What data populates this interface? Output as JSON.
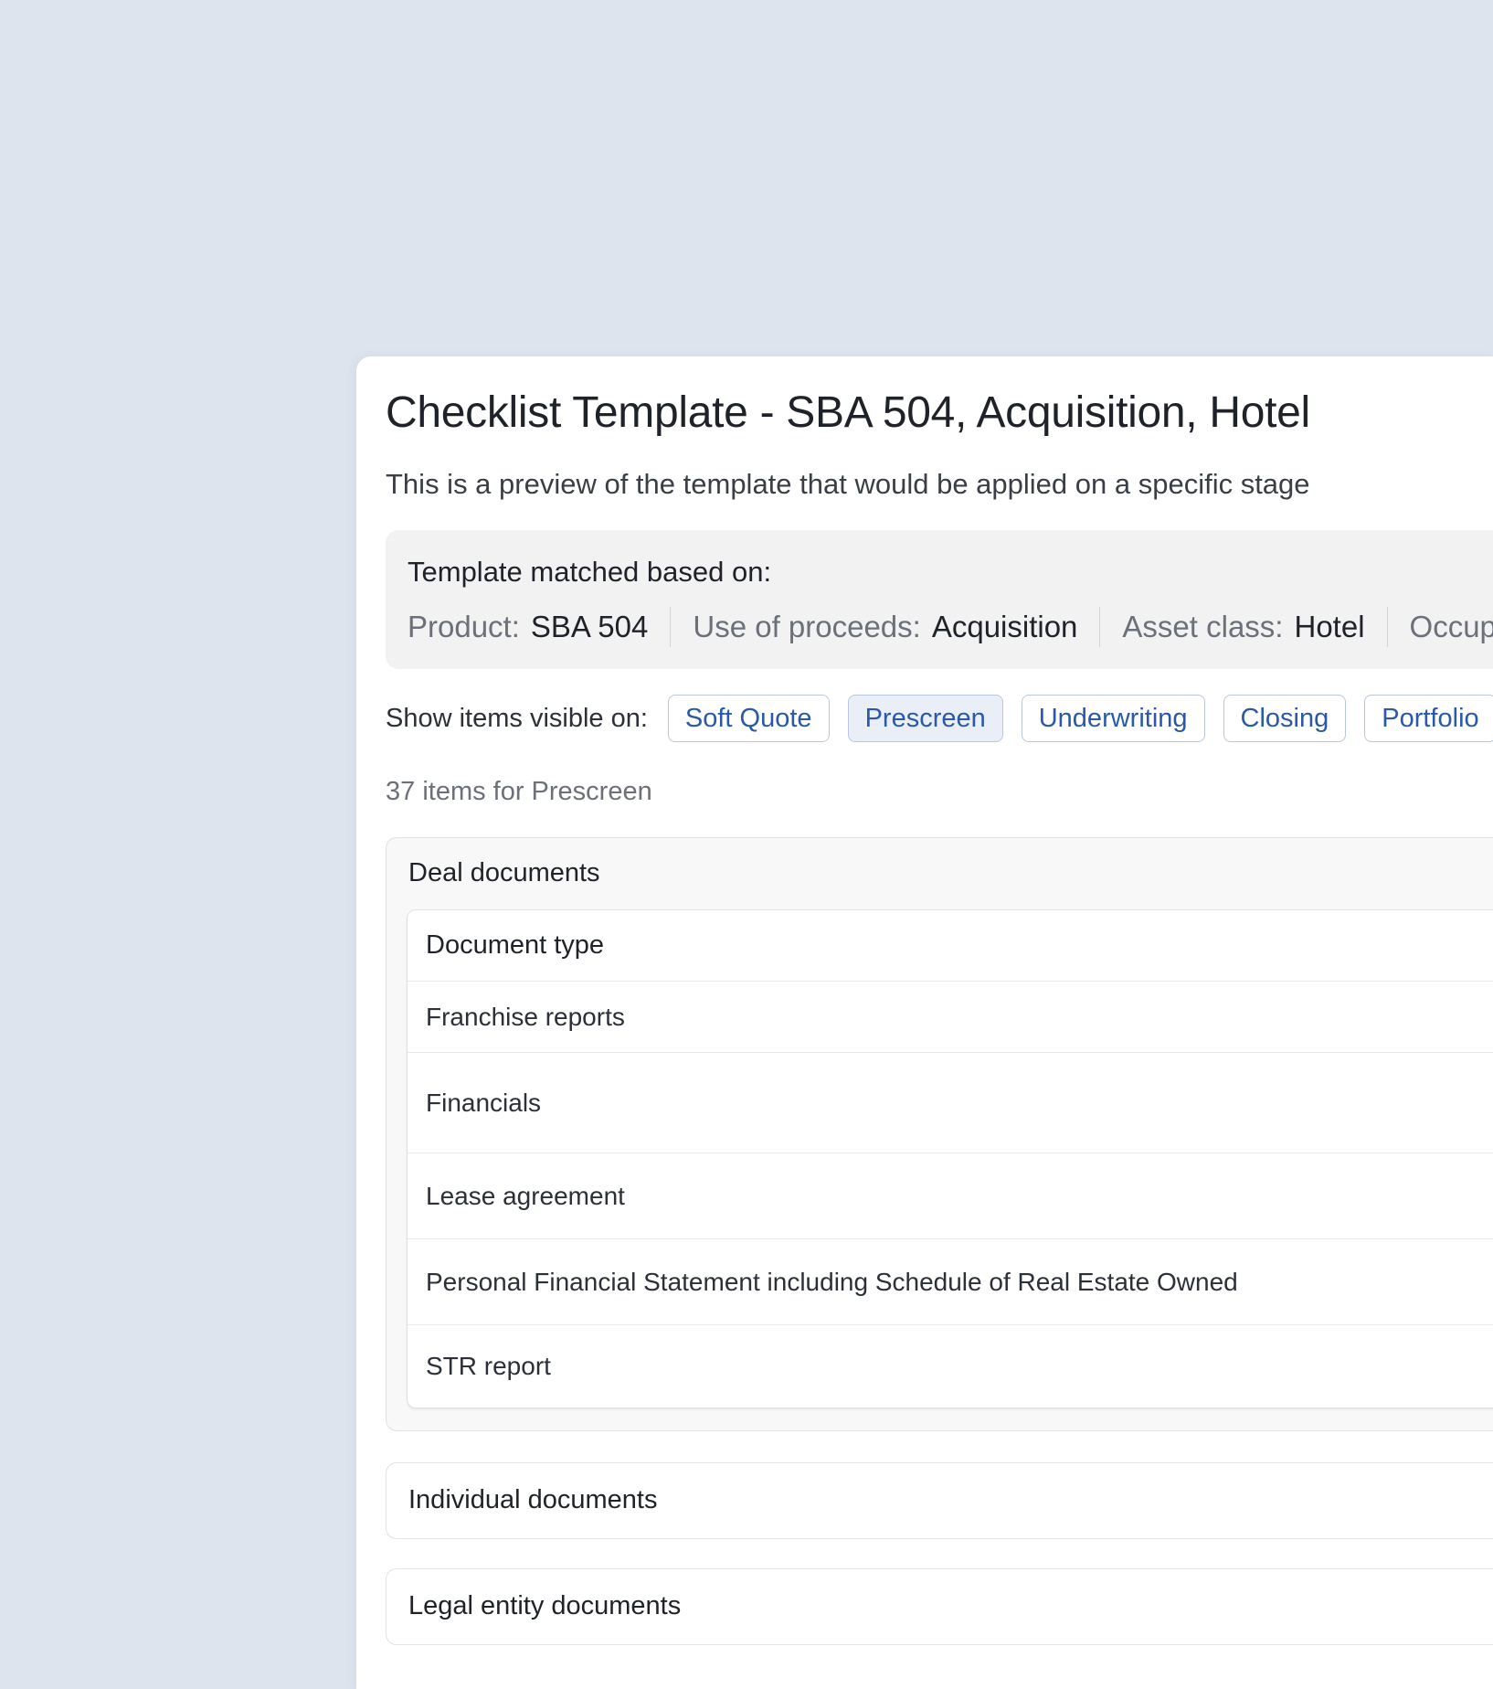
{
  "title": "Checklist Template - SBA 504, Acquisition, Hotel",
  "subtitle": "This is a preview of the template that would be applied on a specific stage",
  "match": {
    "heading": "Template matched based on:",
    "criteria": [
      {
        "label": "Product:",
        "value": "SBA 504"
      },
      {
        "label": "Use of proceeds:",
        "value": "Acquisition"
      },
      {
        "label": "Asset class:",
        "value": "Hotel"
      },
      {
        "label": "Occupan",
        "value": ""
      }
    ]
  },
  "visibility": {
    "label": "Show items visible on:",
    "stages": [
      "Soft Quote",
      "Prescreen",
      "Underwriting",
      "Closing",
      "Portfolio"
    ],
    "active_stage": "Prescreen"
  },
  "items_count": "37 items for Prescreen",
  "sections": {
    "deal_documents": {
      "title": "Deal documents",
      "table_header": "Document type",
      "rows": [
        "Franchise reports",
        "Financials",
        "Lease agreement",
        "Personal Financial Statement including Schedule of Real Estate Owned",
        "STR report"
      ]
    },
    "individual_documents": {
      "title": "Individual documents"
    },
    "legal_entity_documents": {
      "title": "Legal entity documents"
    }
  }
}
